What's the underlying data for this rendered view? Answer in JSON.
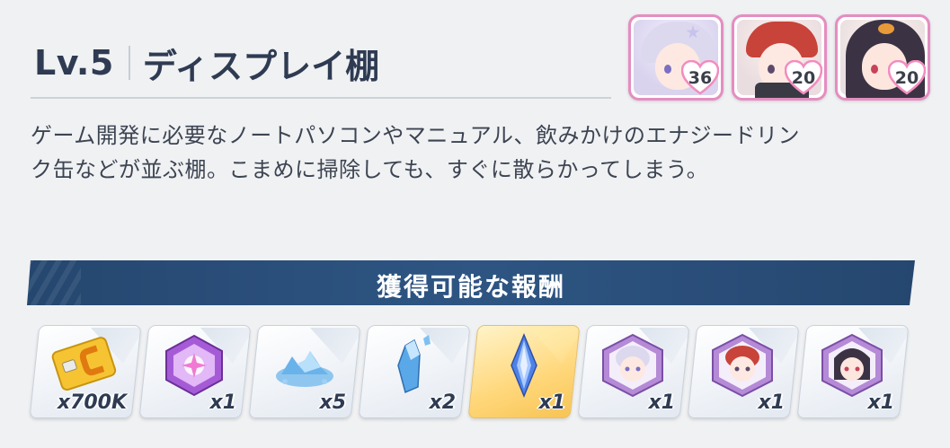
{
  "header": {
    "level": "Lv.5",
    "title": "ディスプレイ棚"
  },
  "students": [
    {
      "affection": "36",
      "hair_color": "#dcd9ee",
      "accent": "#b8b0e0"
    },
    {
      "affection": "20",
      "hair_color": "#c8433a",
      "accent": "#e56a5a"
    },
    {
      "affection": "20",
      "hair_color": "#3b3344",
      "accent": "#5a4e66"
    }
  ],
  "description": {
    "line1": "ゲーム開発に必要なノートパソコンやマニュアル、飲みかけのエナジードリン",
    "line2": "ク缶などが並ぶ棚。こまめに掃除しても、すぐに散らかってしまう。"
  },
  "rewards_banner": {
    "title": "獲得可能な報酬"
  },
  "rewards": [
    {
      "icon": "credit-card-icon",
      "quantity": "x700K"
    },
    {
      "icon": "purple-gem-icon",
      "quantity": "x1"
    },
    {
      "icon": "blue-crystal-pile-icon",
      "quantity": "x5"
    },
    {
      "icon": "blue-crystal-shard-icon",
      "quantity": "x2"
    },
    {
      "icon": "blue-crystal-icon",
      "quantity": "x1"
    },
    {
      "icon": "student-eleph-icon",
      "quantity": "x1"
    },
    {
      "icon": "student-eleph-icon",
      "quantity": "x1"
    },
    {
      "icon": "student-eleph-icon",
      "quantity": "x1"
    }
  ],
  "colors": {
    "banner": "#2a4e7a",
    "heart": "#f28cbf",
    "frame": "#e58dc1",
    "gold_tile": "#ffd77a"
  }
}
